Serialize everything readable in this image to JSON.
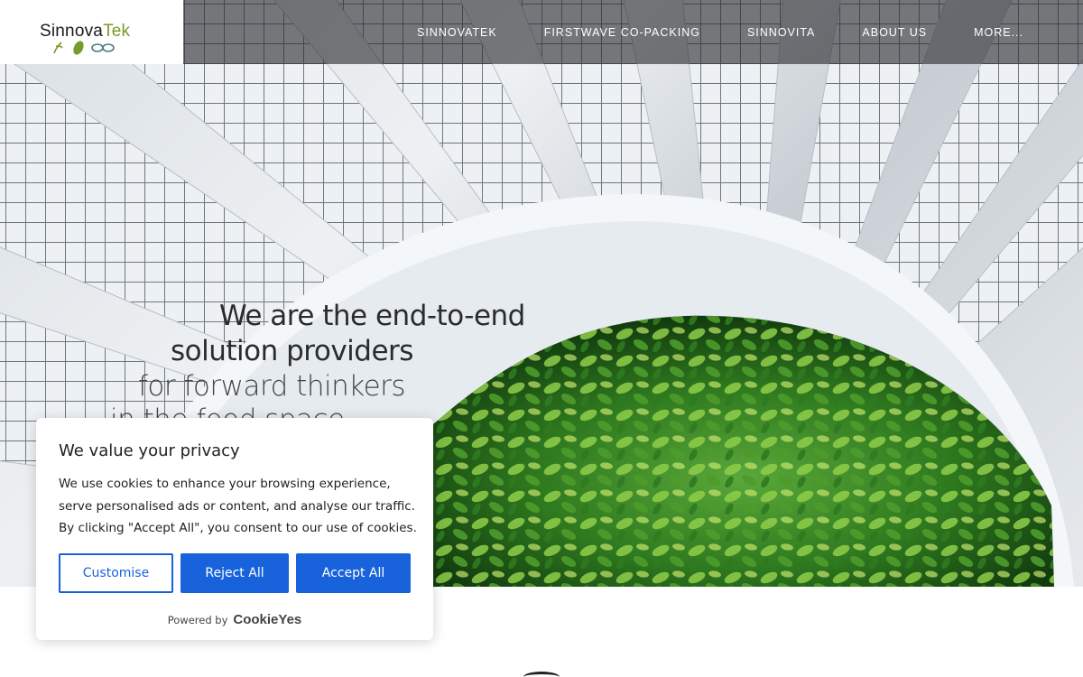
{
  "brand": {
    "name_part1": "Sinnova",
    "name_part2": "Tek",
    "accent_color": "#7a9a2a"
  },
  "nav": {
    "items": [
      {
        "label": "SINNOVATEK"
      },
      {
        "label": "FIRSTWAVE CO-PACKING"
      },
      {
        "label": "SINNOVITA"
      },
      {
        "label": "ABOUT US"
      },
      {
        "label": "MORE..."
      }
    ]
  },
  "hero": {
    "line1": "We are the end-to-end",
    "line2": "solution providers",
    "line3": "for forward thinkers",
    "line4": "in the food space"
  },
  "cookie_banner": {
    "title": "We value your privacy",
    "body": "We use cookies to enhance your browsing experience, serve personalised ads or content, and analyse our traffic. By clicking \"Accept All\", you consent to our use of cookies.",
    "customise_label": "Customise",
    "reject_label": "Reject All",
    "accept_label": "Accept All",
    "powered_label": "Powered by",
    "powered_brand": "CookieYes",
    "button_color": "#1863dc"
  }
}
